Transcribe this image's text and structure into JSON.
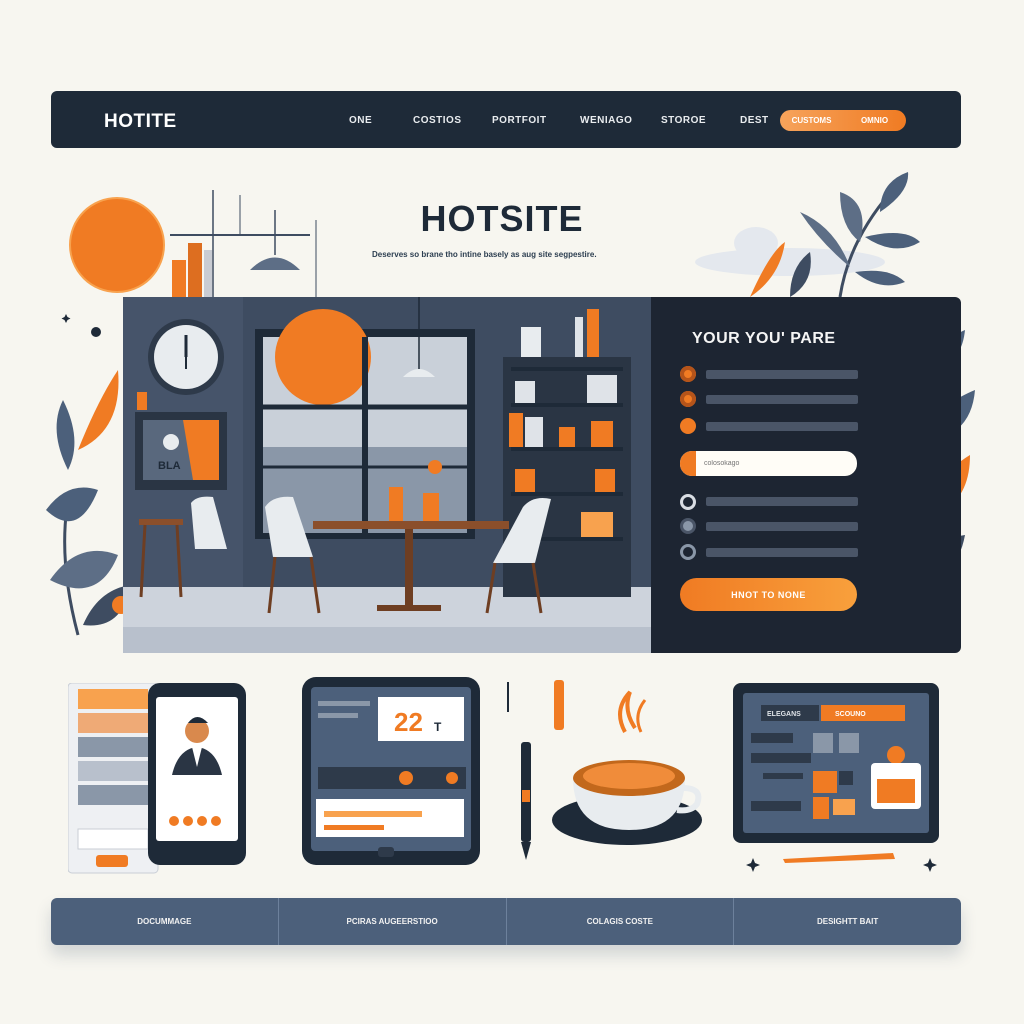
{
  "nav": {
    "logo": "HOTITE",
    "links": [
      "ONE",
      "COSTIOS",
      "PORTFOIT",
      "WENIAGO",
      "STOROE",
      "DEST"
    ],
    "pill_left": "CUSTOMS",
    "pill_right": "OMNIO"
  },
  "hero": {
    "title": "HOTSITE",
    "subtitle": "Deserves so brane tho intine basely as aug site segpestire."
  },
  "room": {
    "screen_text": "BLA"
  },
  "form": {
    "title": "YOUR YOU' PARE",
    "input_placeholder": "colosokago",
    "submit_label": "HNOT TO NONE"
  },
  "tablet": {
    "number": "22",
    "unit": "T"
  },
  "desktop": {
    "tab_left": "ELEGANS",
    "tab_right": "SCOUNO"
  },
  "tabs": [
    "DOCUMMAGE",
    "PCIRAS AUGEERSTIOO",
    "COLAGIS COSTE",
    "DESIGHTT BAIT"
  ],
  "colors": {
    "navy": "#1e2a38",
    "slate": "#4c607b",
    "orange": "#f07b23",
    "cream": "#f7f6f0"
  }
}
